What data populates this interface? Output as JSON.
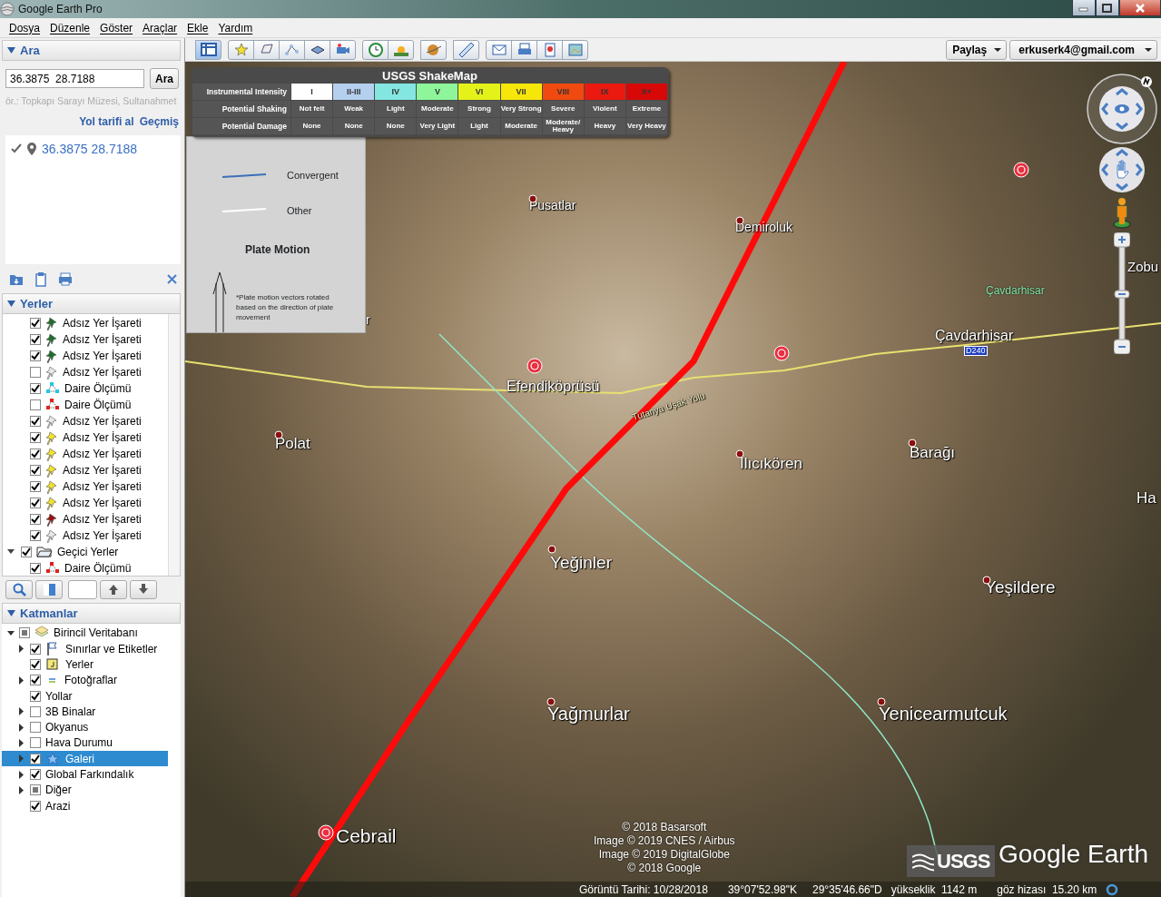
{
  "window": {
    "title": "Google Earth Pro"
  },
  "menu": [
    "Dosya",
    "Düzenle",
    "Göster",
    "Araçlar",
    "Ekle",
    "Yardım"
  ],
  "search": {
    "title": "Ara",
    "query": "36.3875  28.7188",
    "button": "Ara",
    "hint": "ör.: Topkapı Sarayı Müzesi, Sultanahmet",
    "links": [
      "Yol tarifi al",
      "Geçmiş"
    ],
    "results": [
      {
        "text": "36.3875 28.7188",
        "checked": true
      }
    ]
  },
  "places": {
    "title": "Yerler",
    "items": [
      {
        "label": "Adsız Yer İşareti",
        "checked": true,
        "kind": "pin",
        "color": "#1f6e2a"
      },
      {
        "label": "Adsız Yer İşareti",
        "checked": true,
        "kind": "pin",
        "color": "#1f6e2a"
      },
      {
        "label": "Adsız Yer İşareti",
        "checked": true,
        "kind": "pin",
        "color": "#1f6e2a"
      },
      {
        "label": "Adsız Yer İşareti",
        "checked": false,
        "kind": "pin",
        "color": "#e8e8e8"
      },
      {
        "label": "Daire Ölçümü",
        "checked": true,
        "kind": "circle",
        "color": "#22c8e0"
      },
      {
        "label": "Daire Ölçümü",
        "checked": false,
        "kind": "circle",
        "color": "#e02020"
      },
      {
        "label": "Adsız Yer İşareti",
        "checked": true,
        "kind": "pin",
        "color": "#e8e8e8"
      },
      {
        "label": "Adsız Yer İşareti",
        "checked": true,
        "kind": "pin",
        "color": "#f2e22a"
      },
      {
        "label": "Adsız Yer İşareti",
        "checked": true,
        "kind": "pin",
        "color": "#f2e22a"
      },
      {
        "label": "Adsız Yer İşareti",
        "checked": true,
        "kind": "pin",
        "color": "#f2e22a"
      },
      {
        "label": "Adsız Yer İşareti",
        "checked": true,
        "kind": "pin",
        "color": "#f2e22a"
      },
      {
        "label": "Adsız Yer İşareti",
        "checked": true,
        "kind": "pin",
        "color": "#f2e22a"
      },
      {
        "label": "Adsız Yer İşareti",
        "checked": true,
        "kind": "pin",
        "color": "#9a1010"
      },
      {
        "label": "Adsız Yer İşareti",
        "checked": true,
        "kind": "pin",
        "color": "#e8e8e8"
      },
      {
        "label": "Geçici Yerler",
        "checked": true,
        "kind": "folder",
        "expanded": true,
        "children": [
          {
            "label": "Daire Ölçümü",
            "checked": true,
            "kind": "circle",
            "color": "#e02020"
          }
        ]
      }
    ]
  },
  "layers": {
    "title": "Katmanlar",
    "items": [
      {
        "label": "Birincil Veritabanı",
        "partial": true,
        "expanded": true,
        "selected": false,
        "children": [
          {
            "label": "Sınırlar ve Etiketler",
            "checked": true,
            "expanded": false,
            "selected": false
          },
          {
            "label": "Yerler",
            "checked": true,
            "selected": false
          },
          {
            "label": "Fotoğraflar",
            "checked": true,
            "expanded": false,
            "selected": false
          },
          {
            "label": "Yollar",
            "checked": true,
            "selected": false
          },
          {
            "label": "3B Binalar",
            "checked": false,
            "expanded": false,
            "selected": false
          },
          {
            "label": "Okyanus",
            "checked": false,
            "expanded": false,
            "selected": false
          },
          {
            "label": "Hava Durumu",
            "checked": false,
            "expanded": false,
            "selected": false
          },
          {
            "label": "Galeri",
            "checked": true,
            "expanded": false,
            "selected": true
          },
          {
            "label": "Global Farkındalık",
            "checked": true,
            "expanded": false,
            "selected": false
          },
          {
            "label": "Diğer",
            "partial": true,
            "expanded": false,
            "selected": false
          },
          {
            "label": "Arazi",
            "checked": true,
            "selected": false
          }
        ]
      }
    ]
  },
  "zoom": {
    "level": 0.5
  },
  "toolbar": {
    "share": "Paylaş",
    "account": "erkuserk4@gmail.com"
  },
  "shakemap": {
    "title": "USGS ShakeMap",
    "row_labels": [
      "Instrumental Intensity",
      "Potential Shaking",
      "Potential Damage"
    ],
    "columns": [
      {
        "intensity": "I",
        "shaking": "Not felt",
        "damage": "None",
        "color": "#ffffff"
      },
      {
        "intensity": "II-III",
        "shaking": "Weak",
        "damage": "None",
        "color": "#b4d0ee"
      },
      {
        "intensity": "IV",
        "shaking": "Light",
        "damage": "None",
        "color": "#84e6e0"
      },
      {
        "intensity": "V",
        "shaking": "Moderate",
        "damage": "Very Light",
        "color": "#8ef59a"
      },
      {
        "intensity": "VI",
        "shaking": "Strong",
        "damage": "Light",
        "color": "#e4f21a"
      },
      {
        "intensity": "VII",
        "shaking": "Very Strong",
        "damage": "Moderate",
        "color": "#f6e60a"
      },
      {
        "intensity": "VIII",
        "shaking": "Severe",
        "damage": "Moderate/ Heavy",
        "color": "#f04a10"
      },
      {
        "intensity": "IX",
        "shaking": "Violent",
        "damage": "Heavy",
        "color": "#ea1a10"
      },
      {
        "intensity": "X+",
        "shaking": "Extreme",
        "damage": "Very Heavy",
        "color": "#d80808"
      }
    ]
  },
  "plate_legend": {
    "boundaries": [
      {
        "label": "Convergent",
        "color": "#3a6fb8"
      },
      {
        "label": "Other",
        "color": "#ffffff"
      }
    ],
    "motion_title": "Plate Motion",
    "note": "*Plate motion vectors rotated based on the direction of plate movement"
  },
  "map_labels": [
    {
      "text": "r",
      "kind": "town"
    },
    {
      "text": "Pusatlar",
      "kind": "town"
    },
    {
      "text": "Demiroluk",
      "kind": "town"
    },
    {
      "text": "Çavdarhisar",
      "kind": "district"
    },
    {
      "text": "Çavdarhisar",
      "kind": "town"
    },
    {
      "text": "D240",
      "kind": "shield"
    },
    {
      "text": "Efendiköprüsü",
      "kind": "town"
    },
    {
      "text": "Tutanya Uşak Yolu",
      "kind": "road"
    },
    {
      "text": "Polat",
      "kind": "town"
    },
    {
      "text": "Ilıcıkören",
      "kind": "town"
    },
    {
      "text": "Barağı",
      "kind": "town"
    },
    {
      "text": "Ha",
      "kind": "town"
    },
    {
      "text": "Zobu",
      "kind": "town"
    },
    {
      "text": "Yeğinler",
      "kind": "town"
    },
    {
      "text": "Yeşildere",
      "kind": "town"
    },
    {
      "text": "Yağmurlar",
      "kind": "town"
    },
    {
      "text": "Yenicearmutcuk",
      "kind": "town"
    },
    {
      "text": "Cebrail",
      "kind": "town"
    }
  ],
  "attribution": [
    "© 2018 Basarsoft",
    "Image © 2019 CNES / Airbus",
    "Image © 2019 DigitalGlobe",
    "© 2018 Google"
  ],
  "logos": {
    "usgs": "USGS",
    "google_earth": "Google Earth"
  },
  "status_bar": [
    "Görüntü Tarihi: 10/28/2018",
    "39°07'52.98\"K",
    "29°35'46.66\"D",
    "yükseklik  1142 m",
    "göz hizası  15.20 km"
  ]
}
